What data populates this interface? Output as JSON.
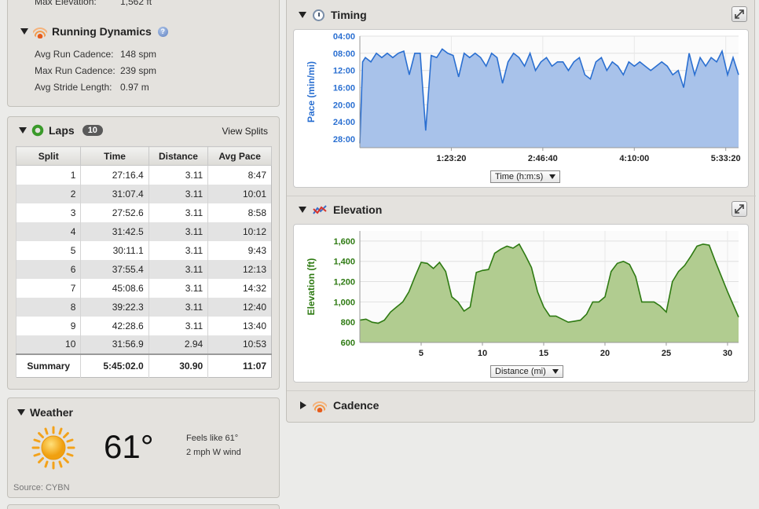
{
  "running_dynamics": {
    "top_label": "Max Elevation:",
    "top_value": "1,562 ft",
    "title": "Running Dynamics",
    "help": "?",
    "rows": [
      {
        "label": "Avg Run Cadence:",
        "value": "148 spm"
      },
      {
        "label": "Max Run Cadence:",
        "value": "239 spm"
      },
      {
        "label": "Avg Stride Length:",
        "value": "0.97 m"
      }
    ]
  },
  "laps": {
    "title": "Laps",
    "count": "10",
    "view_splits": "View Splits",
    "columns": [
      "Split",
      "Time",
      "Distance",
      "Avg Pace"
    ],
    "rows": [
      [
        "1",
        "27:16.4",
        "3.11",
        "8:47"
      ],
      [
        "2",
        "31:07.4",
        "3.11",
        "10:01"
      ],
      [
        "3",
        "27:52.6",
        "3.11",
        "8:58"
      ],
      [
        "4",
        "31:42.5",
        "3.11",
        "10:12"
      ],
      [
        "5",
        "30:11.1",
        "3.11",
        "9:43"
      ],
      [
        "6",
        "37:55.4",
        "3.11",
        "12:13"
      ],
      [
        "7",
        "45:08.6",
        "3.11",
        "14:32"
      ],
      [
        "8",
        "39:22.3",
        "3.11",
        "12:40"
      ],
      [
        "9",
        "42:28.6",
        "3.11",
        "13:40"
      ],
      [
        "10",
        "31:56.9",
        "2.94",
        "10:53"
      ]
    ],
    "summary": [
      "Summary",
      "5:45:02.0",
      "30.90",
      "11:07"
    ]
  },
  "weather": {
    "title": "Weather",
    "temp": "61°",
    "feels": "Feels like 61°",
    "wind": "2 mph W wind",
    "source": "Source: CYBN",
    "icon": "sun-icon"
  },
  "timing": {
    "title": "Timing",
    "dropdown": "Time (h:m:s)",
    "icon": "clock-icon"
  },
  "elevation": {
    "title": "Elevation",
    "dropdown": "Distance (mi)",
    "icon": "elevation-icon"
  },
  "cadence": {
    "title": "Cadence",
    "icon": "running-dynamics-icon"
  },
  "chart_data": [
    {
      "type": "area",
      "ylabel": "Pace (min/mi)",
      "xlabel": "",
      "y_ticks": [
        "04:00",
        "08:00",
        "12:00",
        "16:00",
        "20:00",
        "24:00",
        "28:00"
      ],
      "x_ticks": [
        "1:23:20",
        "2:46:40",
        "4:10:00",
        "5:33:20"
      ],
      "ylim_minutes": [
        30,
        4
      ],
      "xlim_seconds": [
        0,
        20700
      ],
      "y_inverted": true,
      "grid": true,
      "color": "#2a6fd1",
      "fill": "#a8c2ea",
      "x": [
        0,
        150,
        300,
        600,
        900,
        1200,
        1500,
        1800,
        2100,
        2400,
        2700,
        3000,
        3300,
        3600,
        3900,
        4200,
        4500,
        4800,
        5100,
        5400,
        5700,
        6000,
        6300,
        6600,
        6900,
        7200,
        7500,
        7800,
        8100,
        8400,
        8700,
        9000,
        9300,
        9600,
        9900,
        10200,
        10500,
        10800,
        11100,
        11400,
        11700,
        12000,
        12300,
        12600,
        12900,
        13200,
        13500,
        13800,
        14100,
        14400,
        14700,
        15000,
        15300,
        15600,
        15900,
        16200,
        16500,
        16800,
        17100,
        17400,
        17700,
        18000,
        18300,
        18600,
        18900,
        19200,
        19500,
        19800,
        20100,
        20400,
        20700
      ],
      "values": [
        29,
        10,
        9,
        10,
        8,
        9,
        8,
        9,
        8,
        7.5,
        13,
        8,
        8,
        26,
        8.5,
        9,
        7,
        8,
        8.5,
        13.5,
        8,
        9,
        8,
        9,
        11,
        8,
        9,
        15,
        10,
        8,
        9,
        11,
        8,
        12,
        10,
        9,
        11,
        10,
        10,
        12,
        10,
        9,
        13,
        14,
        10,
        9,
        12,
        10,
        11,
        13,
        10,
        11,
        10,
        11,
        12,
        11,
        10,
        11,
        13,
        12,
        16,
        8,
        13,
        9,
        11,
        9,
        10,
        7.5,
        13,
        9,
        13
      ]
    },
    {
      "type": "area",
      "ylabel": "Elevation (ft)",
      "xlabel": "",
      "y_ticks": [
        "600",
        "800",
        "1,000",
        "1,200",
        "1,400",
        "1,600"
      ],
      "x_ticks": [
        "5",
        "10",
        "15",
        "20",
        "25",
        "30"
      ],
      "ylim": [
        600,
        1700
      ],
      "xlim": [
        0,
        30.9
      ],
      "grid": true,
      "color": "#2e7a12",
      "fill": "#b1cc90",
      "x": [
        0,
        0.5,
        1,
        1.5,
        2,
        2.5,
        3,
        3.5,
        4,
        4.5,
        5,
        5.5,
        6,
        6.5,
        7,
        7.5,
        8,
        8.5,
        9,
        9.5,
        10,
        10.5,
        11,
        11.5,
        12,
        12.5,
        13,
        13.5,
        14,
        14.5,
        15,
        15.5,
        16,
        16.5,
        17,
        17.5,
        18,
        18.5,
        19,
        19.5,
        20,
        20.5,
        21,
        21.5,
        22,
        22.5,
        23,
        23.5,
        24,
        24.5,
        25,
        25.5,
        26,
        26.5,
        27,
        27.5,
        28,
        28.5,
        29,
        29.5,
        30,
        30.5,
        30.9
      ],
      "values": [
        820,
        830,
        800,
        790,
        820,
        900,
        950,
        1000,
        1100,
        1250,
        1390,
        1380,
        1330,
        1390,
        1300,
        1050,
        1000,
        910,
        950,
        1290,
        1310,
        1320,
        1480,
        1520,
        1550,
        1530,
        1570,
        1460,
        1340,
        1100,
        950,
        860,
        860,
        830,
        800,
        810,
        820,
        880,
        1000,
        1000,
        1050,
        1300,
        1380,
        1400,
        1370,
        1250,
        1000,
        1000,
        1000,
        960,
        900,
        1200,
        1300,
        1360,
        1450,
        1550,
        1570,
        1560,
        1400,
        1250,
        1100,
        960,
        850
      ]
    }
  ]
}
